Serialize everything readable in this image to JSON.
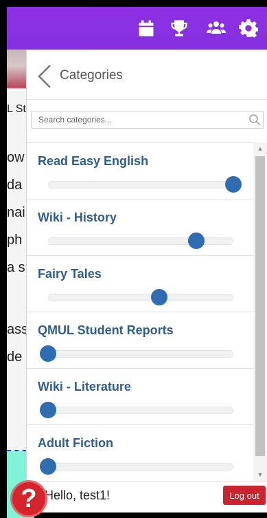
{
  "topbar": {
    "icons": [
      "calendar-icon",
      "trophy-icon",
      "users-icon",
      "gear-icon"
    ],
    "color": "#8a2be2"
  },
  "background_page": {
    "text_fragments": [
      "L St",
      "ow",
      "da",
      "nai",
      "ph",
      "a s",
      "ass",
      "de"
    ]
  },
  "panel": {
    "title": "Categories",
    "search_placeholder": "Search categories...",
    "categories": [
      {
        "name": "Read Easy English",
        "level": 1.0
      },
      {
        "name": "Wiki - History",
        "level": 0.8
      },
      {
        "name": "Fairy Tales",
        "level": 0.6
      },
      {
        "name": "QMUL Student Reports",
        "level": 0.0
      },
      {
        "name": "Wiki - Literature",
        "level": 0.0
      },
      {
        "name": "Adult Fiction",
        "level": 0.0
      }
    ],
    "greeting": "Hello, test1!",
    "logout_label": "Log out"
  },
  "help": {
    "label": "?"
  },
  "colors": {
    "accent": "#8a2be2",
    "category_text": "#2f5d8f",
    "slider_thumb": "#2f6db0",
    "logout": "#c9242f",
    "help": "#d4242c"
  }
}
